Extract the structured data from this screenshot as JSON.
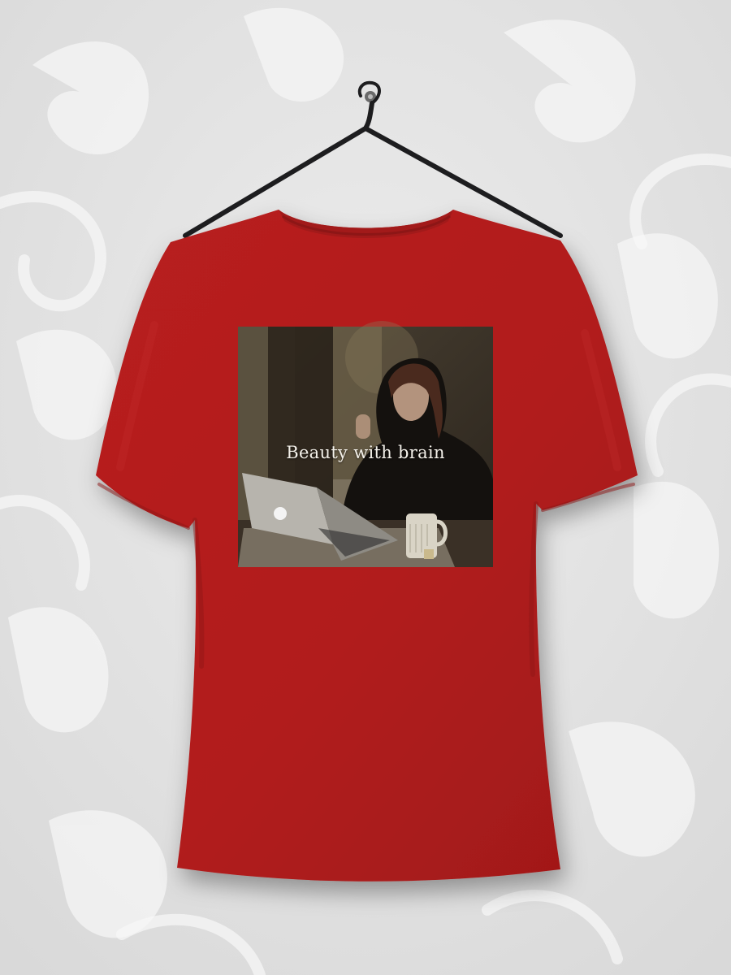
{
  "print": {
    "caption": "Beauty with brain"
  },
  "colors": {
    "shirt": "#b31e1e",
    "shirt_shadow": "#8d1616",
    "background": "#e4e4e4",
    "hanger": "#1d1d1f",
    "print_bg": "#3b3328"
  }
}
